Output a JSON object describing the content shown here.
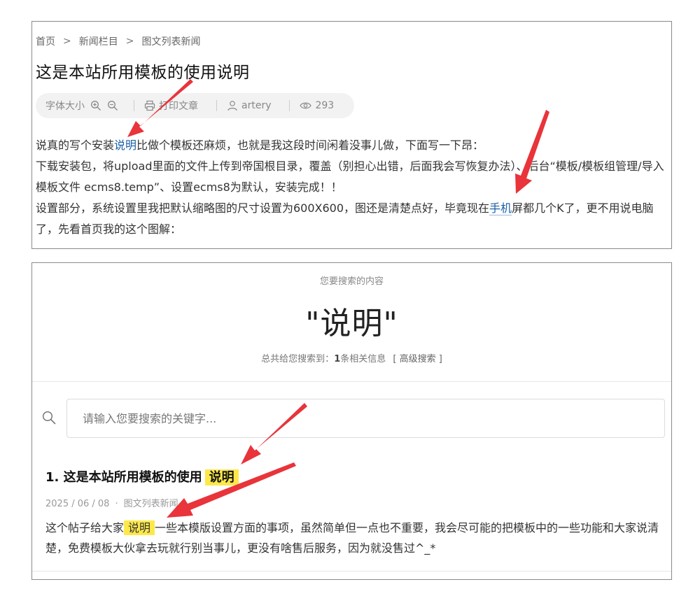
{
  "article": {
    "breadcrumb": [
      "首页",
      "新闻栏目",
      "图文列表新闻"
    ],
    "breadcrumb_sep": ">",
    "title": "这是本站所用模板的使用说明",
    "toolbar": {
      "font_size_label": "字体大小",
      "print_label": "打印文章",
      "author": "artery",
      "views": "293"
    },
    "body": {
      "p1_before": "说真的写个安装",
      "p1_link": "说明",
      "p1_after": "比做个模板还麻烦，也就是我这段时间闲着没事儿做，下面写一下昂：",
      "p2": "下载安装包，将upload里面的文件上传到帝国根目录，覆盖（别担心出错，后面我会写恢复办法）、后台“模板/模板组管理/导入模板文件 ecms8.temp”、设置ecms8为默认，安装完成！！",
      "p3_before": "设置部分，系统设置里我把默认缩略图的尺寸设置为600X600，图还是清楚点好，毕竟现在",
      "p3_link": "手机",
      "p3_after": "屏都几个K了，更不用说电脑了，先看首页我的这个图解："
    }
  },
  "search": {
    "heading_small": "您要搜索的内容",
    "query_display": "\"说明\"",
    "summary_prefix": "总共给您搜索到：",
    "summary_count": "1",
    "summary_suffix": "条相关信息",
    "advanced_link": "[ 高级搜索 ]",
    "input_placeholder": "请输入您要搜索的关键字...",
    "input_value": "",
    "results": [
      {
        "index": "1.",
        "title_before": "这是本站所用模板的使用",
        "title_highlight": "说明",
        "date": "2025 / 06 / 08",
        "meta_dot": "·",
        "category": "图文列表新闻",
        "snippet_before": "这个帖子给大家",
        "snippet_highlight": "说明",
        "snippet_after": "一些本模版设置方面的事项，虽然简单但一点也不重要，我会尽可能的把模板中的一些功能和大家说清楚，免费模板大伙拿去玩就行别当事儿，更没有啥售后服务，因为就没售过^_*"
      }
    ]
  },
  "colors": {
    "highlight": "#fde84a",
    "link": "#1a5fa8",
    "arrow": "#e8343a",
    "border": "#8a8a8a"
  },
  "icons": [
    "zoom-in-icon",
    "zoom-out-icon",
    "print-icon",
    "user-icon",
    "eye-icon",
    "search-icon"
  ]
}
